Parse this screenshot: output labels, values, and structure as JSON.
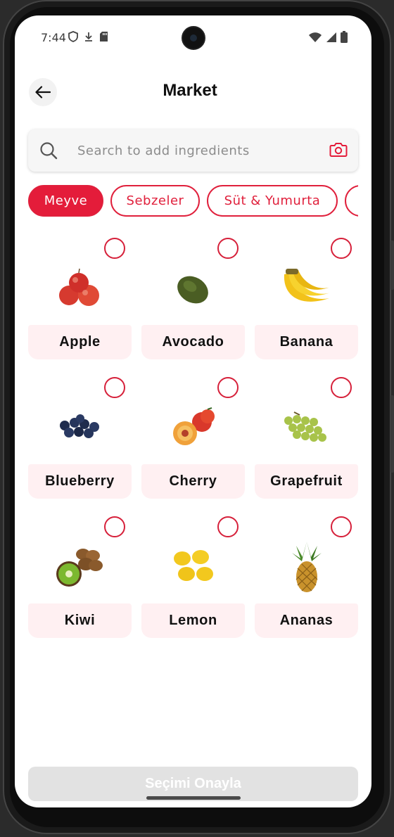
{
  "status": {
    "time": "7:44",
    "icons_left": [
      "shield-icon",
      "download-icon",
      "sd-card-icon"
    ],
    "icons_right": [
      "wifi-icon",
      "signal-icon",
      "battery-icon"
    ]
  },
  "header": {
    "title": "Market",
    "back_icon": "arrow-left-icon"
  },
  "search": {
    "placeholder": "Search to add ingredients",
    "value": ""
  },
  "categories": [
    {
      "label": "Meyve",
      "active": true
    },
    {
      "label": "Sebzeler",
      "active": false
    },
    {
      "label": "Süt & Yumurta",
      "active": false
    },
    {
      "label": "",
      "active": false
    }
  ],
  "items": [
    {
      "name": "Apple",
      "selected": false
    },
    {
      "name": "Avocado",
      "selected": false
    },
    {
      "name": "Banana",
      "selected": false
    },
    {
      "name": "Blueberry",
      "selected": false
    },
    {
      "name": "Cherry",
      "selected": false
    },
    {
      "name": "Grapefruit",
      "selected": false
    },
    {
      "name": "Kiwi",
      "selected": false
    },
    {
      "name": "Lemon",
      "selected": false
    },
    {
      "name": "Ananas",
      "selected": false
    }
  ],
  "confirm": {
    "label": "Seçimi Onayla",
    "enabled": false
  },
  "colors": {
    "accent": "#e41c3a",
    "card_label_bg": "#fff0f2",
    "disabled_button": "#e2e2e2"
  }
}
